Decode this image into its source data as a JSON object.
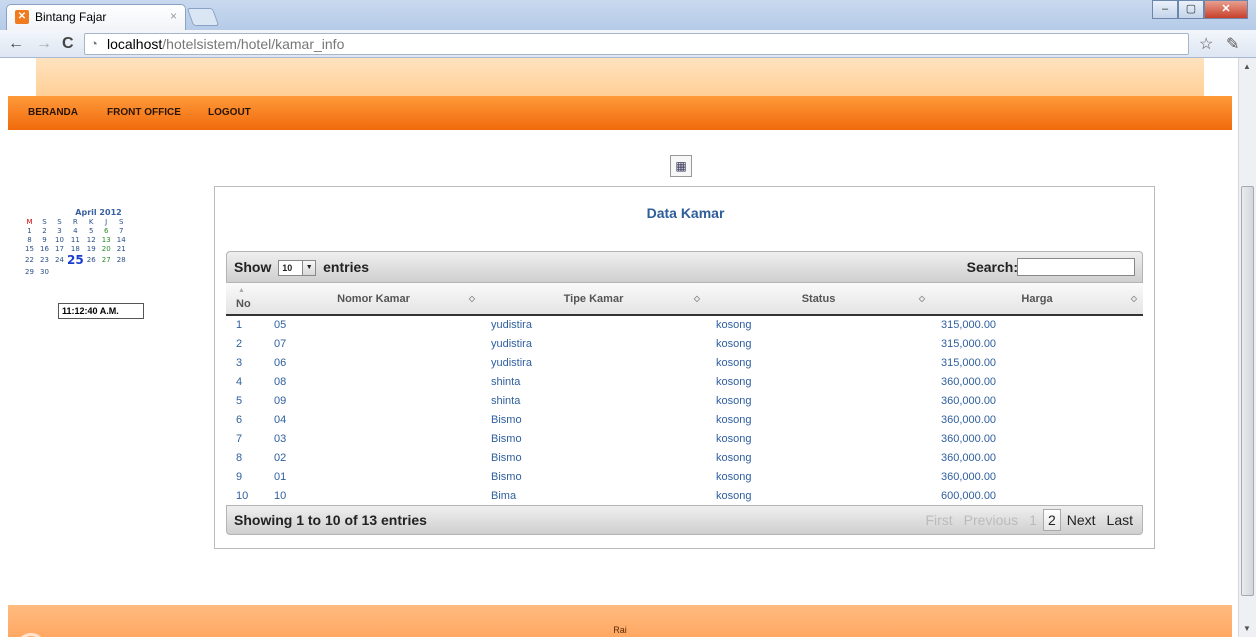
{
  "browser": {
    "tab_title": "Bintang Fajar",
    "tab_close": "×",
    "url_host": "localhost",
    "url_path": "/hotelsistem/hotel/kamar_info"
  },
  "menu": [
    "BERANDA",
    "FRONT OFFICE",
    "LOGOUT"
  ],
  "calendar": {
    "month": "April 2012",
    "days_header": [
      "M",
      "S",
      "S",
      "R",
      "K",
      "J",
      "S"
    ],
    "weeks": [
      [
        "1",
        "2",
        "3",
        "4",
        "5",
        "6",
        "7"
      ],
      [
        "8",
        "9",
        "10",
        "11",
        "12",
        "13",
        "14"
      ],
      [
        "15",
        "16",
        "17",
        "18",
        "19",
        "20",
        "21"
      ],
      [
        "22",
        "23",
        "24",
        "25",
        "26",
        "27",
        "28"
      ],
      [
        "29",
        "30",
        "",
        "",
        "",
        "",
        ""
      ]
    ],
    "today": "25",
    "clock": "11:12:40 A.M."
  },
  "panel": {
    "title": "Data Kamar",
    "show_label": "Show",
    "entries_value": "10",
    "entries_label": "entries",
    "search_label": "Search:",
    "columns": [
      "No",
      "Nomor Kamar",
      "Tipe Kamar",
      "Status",
      "Harga"
    ],
    "rows": [
      [
        "1",
        "05",
        "yudistira",
        "kosong",
        "315,000.00"
      ],
      [
        "2",
        "07",
        "yudistira",
        "kosong",
        "315,000.00"
      ],
      [
        "3",
        "06",
        "yudistira",
        "kosong",
        "315,000.00"
      ],
      [
        "4",
        "08",
        "shinta",
        "kosong",
        "360,000.00"
      ],
      [
        "5",
        "09",
        "shinta",
        "kosong",
        "360,000.00"
      ],
      [
        "6",
        "04",
        "Bismo",
        "kosong",
        "360,000.00"
      ],
      [
        "7",
        "03",
        "Bismo",
        "kosong",
        "360,000.00"
      ],
      [
        "8",
        "02",
        "Bismo",
        "kosong",
        "360,000.00"
      ],
      [
        "9",
        "01",
        "Bismo",
        "kosong",
        "360,000.00"
      ],
      [
        "10",
        "10",
        "Bima",
        "kosong",
        "600,000.00"
      ]
    ],
    "info": "Showing 1 to 10 of 13 entries",
    "pager": {
      "first": "First",
      "previous": "Previous",
      "p1": "1",
      "p2": "2",
      "next": "Next",
      "last": "Last"
    }
  },
  "footer": {
    "text": "Rai"
  },
  "colors": {
    "menubar": "#f06a0c",
    "link": "#2f5f9e",
    "title": "#2e5d9a"
  }
}
